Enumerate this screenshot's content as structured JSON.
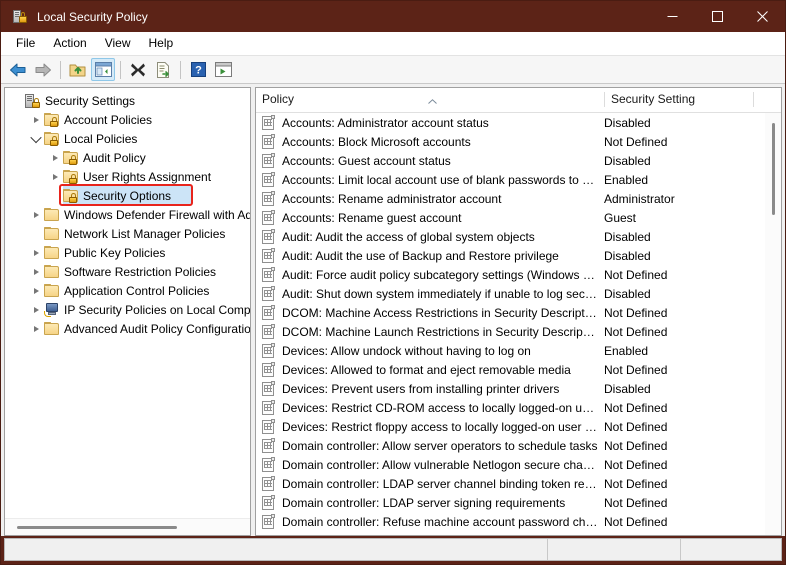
{
  "window": {
    "title": "Local Security Policy",
    "app_icon": "security-policy-icon",
    "accent_titlebar_color": "#5c2317",
    "controls": {
      "minimize": "minimize-button",
      "maximize": "maximize-button",
      "close": "close-button"
    }
  },
  "menubar": {
    "items": [
      {
        "label": "File"
      },
      {
        "label": "Action"
      },
      {
        "label": "View"
      },
      {
        "label": "Help"
      }
    ]
  },
  "toolbar": {
    "buttons": [
      {
        "name": "back-button",
        "icon": "back-arrow-icon",
        "enabled": true
      },
      {
        "name": "forward-button",
        "icon": "forward-arrow-icon",
        "enabled": false
      },
      {
        "name": "up-one-level-button",
        "icon": "folder-up-icon",
        "enabled": true
      },
      {
        "name": "show-hide-tree-button",
        "icon": "console-tree-icon",
        "pressed": true
      },
      {
        "name": "delete-button",
        "icon": "delete-x-icon",
        "enabled": true
      },
      {
        "name": "export-list-button",
        "icon": "export-list-icon",
        "enabled": true
      },
      {
        "name": "help-button",
        "icon": "help-question-icon",
        "enabled": true
      },
      {
        "name": "properties-button",
        "icon": "properties-window-icon",
        "enabled": true
      }
    ]
  },
  "tree": {
    "nodes": [
      {
        "label": "Security Settings",
        "depth": 0,
        "twisty": "none",
        "icon": "computer-lock-icon",
        "selected": false
      },
      {
        "label": "Account Policies",
        "depth": 1,
        "twisty": "collapsed",
        "icon": "folder-lock-icon",
        "selected": false
      },
      {
        "label": "Local Policies",
        "depth": 1,
        "twisty": "expanded",
        "icon": "folder-lock-icon",
        "selected": false
      },
      {
        "label": "Audit Policy",
        "depth": 2,
        "twisty": "collapsed",
        "icon": "folder-lock-icon",
        "selected": false
      },
      {
        "label": "User Rights Assignment",
        "depth": 2,
        "twisty": "collapsed",
        "icon": "folder-lock-icon",
        "selected": false
      },
      {
        "label": "Security Options",
        "depth": 2,
        "twisty": "none",
        "icon": "folder-lock-icon",
        "selected": true
      },
      {
        "label": "Windows Defender Firewall with Adva...",
        "depth": 1,
        "twisty": "collapsed",
        "icon": "folder-icon",
        "selected": false
      },
      {
        "label": "Network List Manager Policies",
        "depth": 1,
        "twisty": "none",
        "icon": "folder-icon",
        "selected": false
      },
      {
        "label": "Public Key Policies",
        "depth": 1,
        "twisty": "collapsed",
        "icon": "folder-icon",
        "selected": false
      },
      {
        "label": "Software Restriction Policies",
        "depth": 1,
        "twisty": "collapsed",
        "icon": "folder-icon",
        "selected": false
      },
      {
        "label": "Application Control Policies",
        "depth": 1,
        "twisty": "collapsed",
        "icon": "folder-icon",
        "selected": false
      },
      {
        "label": "IP Security Policies on Local Compute",
        "depth": 1,
        "twisty": "collapsed",
        "icon": "ipsec-computer-icon",
        "selected": false
      },
      {
        "label": "Advanced Audit Policy Configuration",
        "depth": 1,
        "twisty": "collapsed",
        "icon": "folder-icon",
        "selected": false
      }
    ],
    "annotation": {
      "type": "red-highlight-rectangle",
      "target": "Security Options",
      "color": "#e8241c"
    }
  },
  "list": {
    "columns": [
      {
        "label": "Policy",
        "sort": "ascending"
      },
      {
        "label": "Security Setting",
        "sort": "none"
      }
    ],
    "rows": [
      {
        "policy": "Accounts: Administrator account status",
        "setting": "Disabled"
      },
      {
        "policy": "Accounts: Block Microsoft accounts",
        "setting": "Not Defined"
      },
      {
        "policy": "Accounts: Guest account status",
        "setting": "Disabled"
      },
      {
        "policy": "Accounts: Limit local account use of blank passwords to co...",
        "setting": "Enabled"
      },
      {
        "policy": "Accounts: Rename administrator account",
        "setting": "Administrator"
      },
      {
        "policy": "Accounts: Rename guest account",
        "setting": "Guest"
      },
      {
        "policy": "Audit: Audit the access of global system objects",
        "setting": "Disabled"
      },
      {
        "policy": "Audit: Audit the use of Backup and Restore privilege",
        "setting": "Disabled"
      },
      {
        "policy": "Audit: Force audit policy subcategory settings (Windows Vis...",
        "setting": "Not Defined"
      },
      {
        "policy": "Audit: Shut down system immediately if unable to log secur...",
        "setting": "Disabled"
      },
      {
        "policy": "DCOM: Machine Access Restrictions in Security Descriptor D...",
        "setting": "Not Defined"
      },
      {
        "policy": "DCOM: Machine Launch Restrictions in Security Descriptor ...",
        "setting": "Not Defined"
      },
      {
        "policy": "Devices: Allow undock without having to log on",
        "setting": "Enabled"
      },
      {
        "policy": "Devices: Allowed to format and eject removable media",
        "setting": "Not Defined"
      },
      {
        "policy": "Devices: Prevent users from installing printer drivers",
        "setting": "Disabled"
      },
      {
        "policy": "Devices: Restrict CD-ROM access to locally logged-on user ...",
        "setting": "Not Defined"
      },
      {
        "policy": "Devices: Restrict floppy access to locally logged-on user only",
        "setting": "Not Defined"
      },
      {
        "policy": "Domain controller: Allow server operators to schedule tasks",
        "setting": "Not Defined"
      },
      {
        "policy": "Domain controller: Allow vulnerable Netlogon secure chann...",
        "setting": "Not Defined"
      },
      {
        "policy": "Domain controller: LDAP server channel binding token requi...",
        "setting": "Not Defined"
      },
      {
        "policy": "Domain controller: LDAP server signing requirements",
        "setting": "Not Defined"
      },
      {
        "policy": "Domain controller: Refuse machine account password chan...",
        "setting": "Not Defined"
      }
    ]
  },
  "statusbar": {
    "main_text": "",
    "segment2_text": "",
    "segment3_text": ""
  }
}
